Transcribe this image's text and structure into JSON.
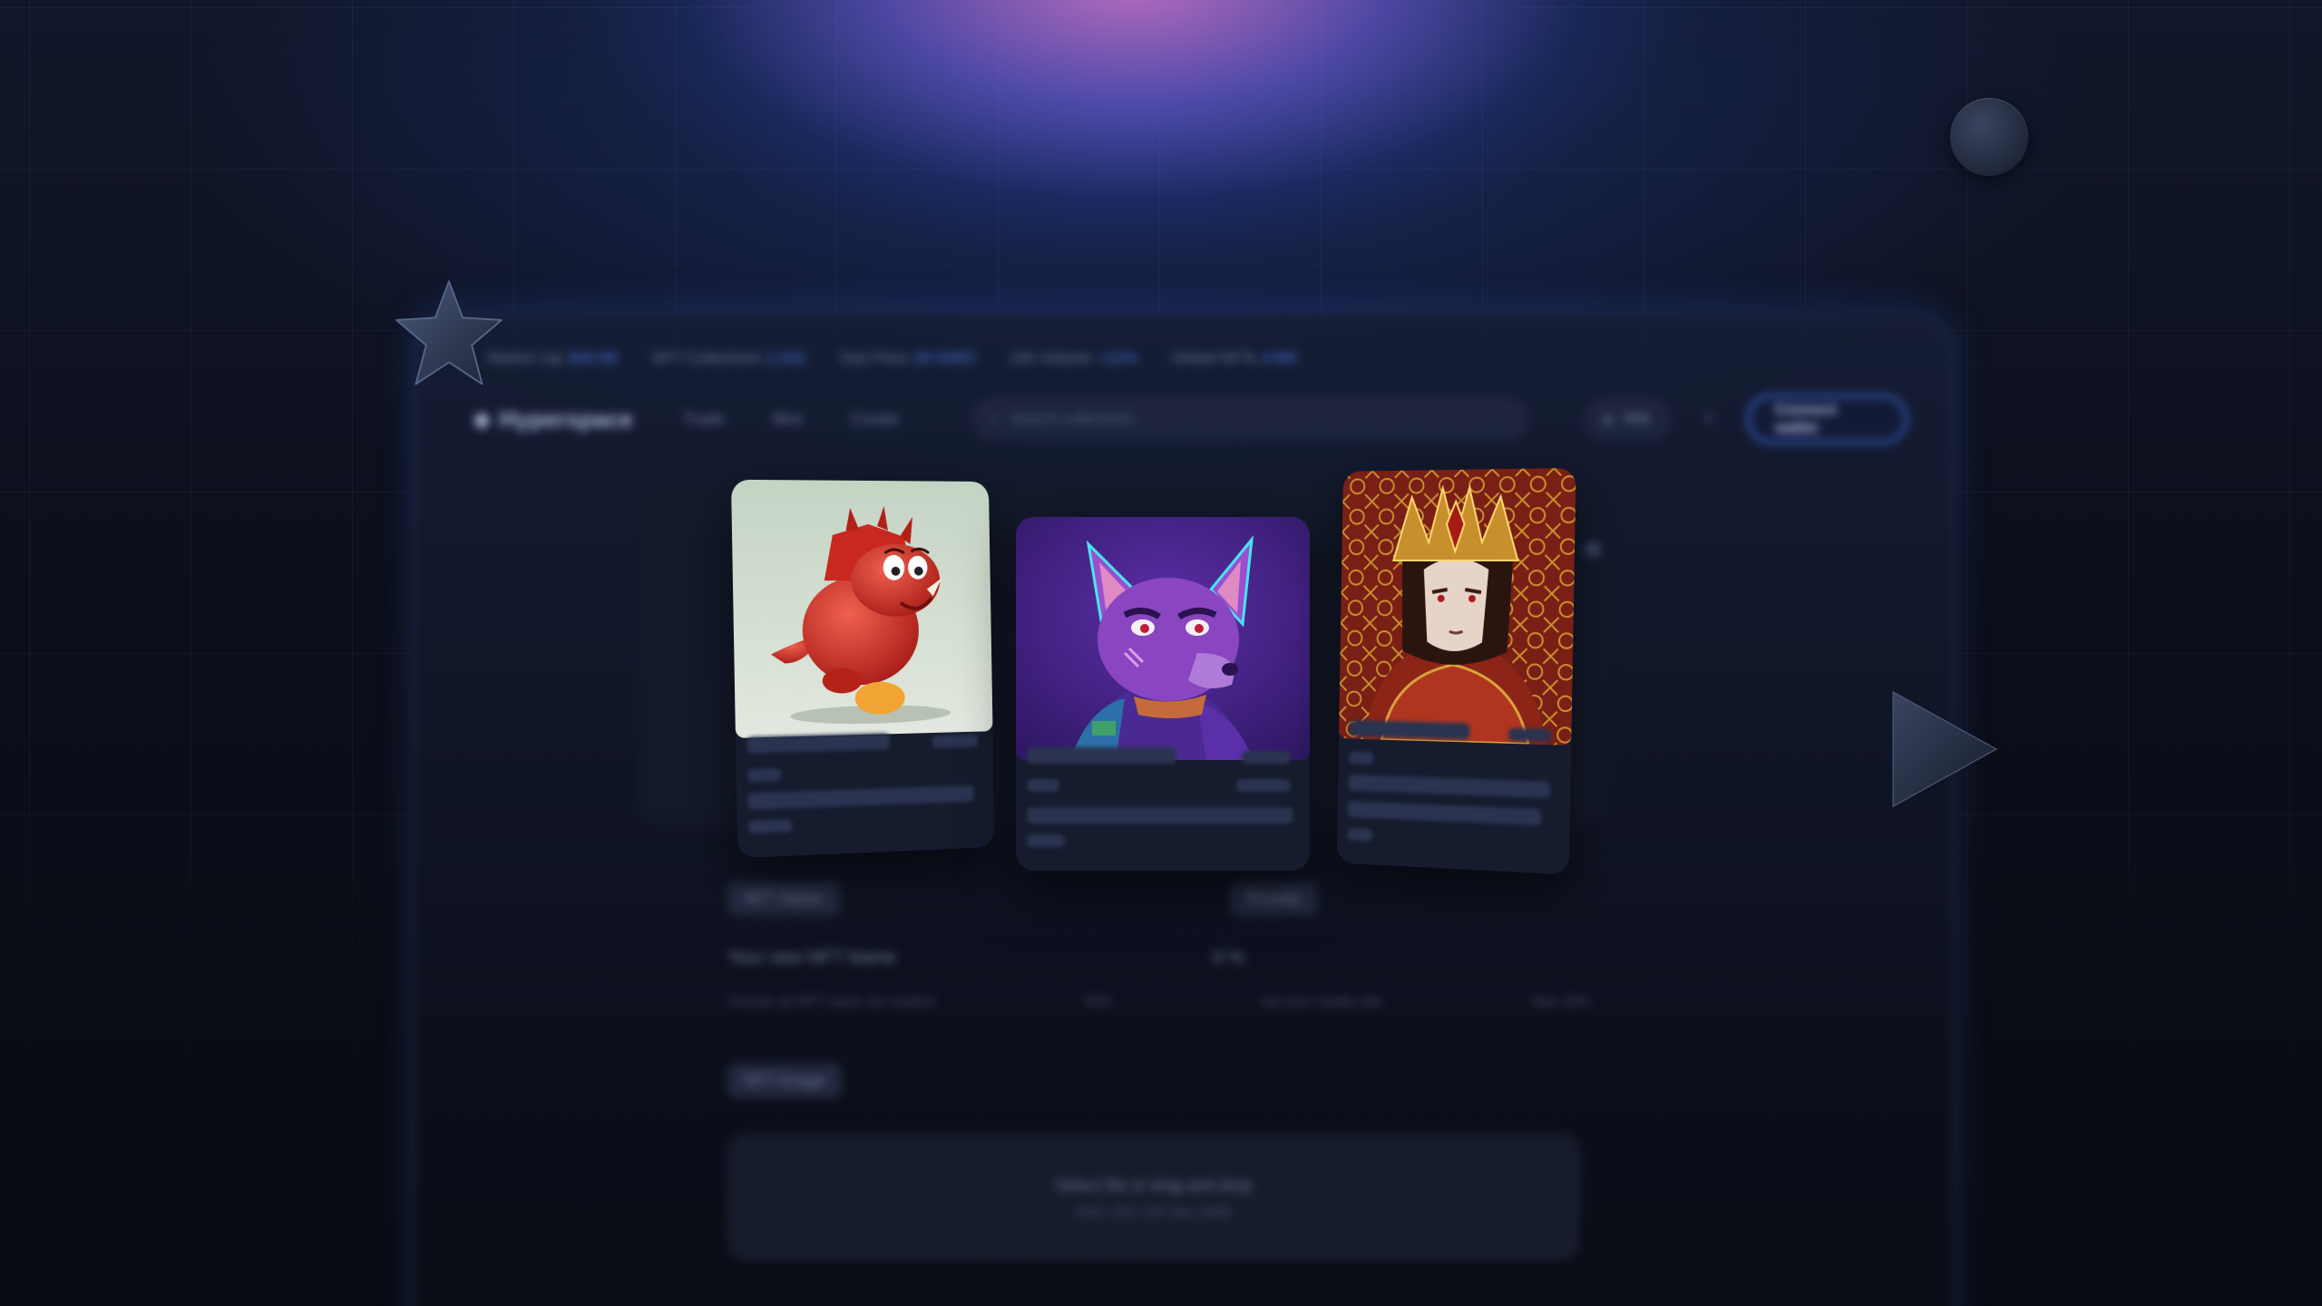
{
  "ticker": [
    {
      "label": "Market cap",
      "value": "$48.6B"
    },
    {
      "label": "NFT Collections",
      "value": "2,432"
    },
    {
      "label": "Gas Price",
      "value": "28 GWEI"
    },
    {
      "label": "24h Volume",
      "value": "+12%"
    },
    {
      "label": "Global NFTs",
      "value": "4.6M"
    }
  ],
  "nav": {
    "logo": "Hyperspace",
    "links": [
      "Trade",
      "Mint",
      "Create"
    ],
    "search_placeholder": "Search collections",
    "network": "SOL",
    "connect_label": "Connect wallet"
  },
  "form": {
    "name_chip": "NFT Name",
    "royalty_chip": "Royalty",
    "name_placeholder": "Your new NFT Name",
    "royalty_value": "0 %",
    "name_hint": "Choose an NFT name, be creative",
    "name_count": "0/30",
    "royalty_hint": "Set your royalty rate",
    "royalty_max": "Max 10%",
    "image_chip": "NFT Image",
    "drop_line1": "Select file or drag and drop",
    "drop_line2": "PNG, JPG, GIF. Max 10MB"
  },
  "cards": [
    {
      "art": "red-dinosaur-character",
      "colors": {
        "bg": "#c9d6c8",
        "accent": "#d93a2e"
      }
    },
    {
      "art": "purple-cyber-fox-character",
      "colors": {
        "bg": "#3c2378",
        "accent": "#8b46c8"
      }
    },
    {
      "art": "armored-warrior-portrait",
      "colors": {
        "bg": "#6a1a14",
        "accent": "#c8902c"
      }
    }
  ],
  "colors": {
    "accent": "#3f6fe0",
    "glow": "#c873d6",
    "background": "#0a0c14"
  }
}
